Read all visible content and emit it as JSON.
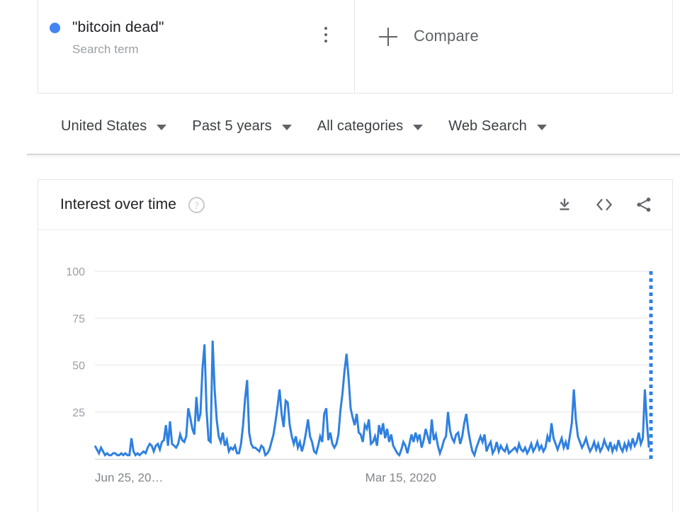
{
  "search_term": {
    "label": "\"bitcoin dead\"",
    "type_label": "Search term",
    "dot_color": "#4285f4",
    "menu_icon": "kebab-menu-icon"
  },
  "compare": {
    "label": "Compare",
    "icon": "plus-icon"
  },
  "filters": [
    {
      "label": "United States",
      "name": "region"
    },
    {
      "label": "Past 5 years",
      "name": "time-range"
    },
    {
      "label": "All categories",
      "name": "category"
    },
    {
      "label": "Web Search",
      "name": "search-type"
    }
  ],
  "card": {
    "title": "Interest over time",
    "help_icon": "question-mark-icon",
    "actions": [
      {
        "name": "download-csv-button",
        "icon": "download-icon"
      },
      {
        "name": "embed-code-button",
        "icon": "code-brackets-icon"
      },
      {
        "name": "share-button",
        "icon": "share-icon"
      }
    ]
  },
  "chart_data": {
    "type": "line",
    "title": "Interest over time",
    "xlabel": "",
    "ylabel": "",
    "ylim": [
      0,
      100
    ],
    "yticks": [
      100,
      75,
      50,
      25
    ],
    "xticks": [
      {
        "label": "Jun 25, 20…",
        "pos": 0.0
      },
      {
        "label": "Mar 15, 2020",
        "pos": 0.55
      }
    ],
    "grid": true,
    "legend": false,
    "line_color": "#2f80e0",
    "series": [
      {
        "name": "\"bitcoin dead\"",
        "values": [
          7,
          5,
          3,
          6,
          4,
          2,
          3,
          2,
          2,
          3,
          3,
          2,
          2,
          3,
          2,
          3,
          2,
          2,
          11,
          4,
          2,
          3,
          2,
          3,
          4,
          3,
          6,
          8,
          7,
          4,
          7,
          8,
          5,
          9,
          10,
          18,
          7,
          20,
          8,
          7,
          6,
          8,
          13,
          10,
          9,
          12,
          27,
          22,
          16,
          13,
          33,
          20,
          24,
          48,
          61,
          26,
          10,
          9,
          63,
          37,
          21,
          12,
          9,
          14,
          7,
          10,
          4,
          6,
          5,
          7,
          3,
          3,
          8,
          18,
          32,
          42,
          14,
          8,
          6,
          6,
          5,
          4,
          7,
          6,
          2,
          3,
          5,
          9,
          13,
          20,
          28,
          37,
          24,
          17,
          31,
          30,
          18,
          12,
          8,
          12,
          6,
          9,
          4,
          8,
          14,
          21,
          12,
          9,
          4,
          3,
          7,
          12,
          9,
          24,
          27,
          10,
          14,
          8,
          6,
          8,
          13,
          26,
          35,
          47,
          56,
          43,
          27,
          22,
          18,
          24,
          14,
          13,
          9,
          18,
          16,
          21,
          8,
          9,
          12,
          7,
          18,
          13,
          19,
          11,
          16,
          9,
          13,
          7,
          5,
          3,
          2,
          5,
          9,
          7,
          3,
          8,
          13,
          9,
          14,
          10,
          13,
          6,
          10,
          16,
          12,
          8,
          21,
          10,
          13,
          7,
          3,
          6,
          10,
          12,
          25,
          15,
          11,
          9,
          13,
          14,
          8,
          12,
          19,
          24,
          15,
          9,
          4,
          2,
          6,
          9,
          12,
          9,
          13,
          4,
          7,
          9,
          3,
          5,
          9,
          4,
          7,
          5,
          4,
          7,
          3,
          4,
          5,
          6,
          4,
          8,
          5,
          4,
          6,
          3,
          5,
          8,
          4,
          6,
          9,
          5,
          7,
          4,
          6,
          12,
          9,
          19,
          11,
          8,
          5,
          8,
          11,
          6,
          9,
          5,
          12,
          19,
          37,
          21,
          12,
          9,
          6,
          8,
          11,
          7,
          4,
          6,
          9,
          5,
          8,
          4,
          6,
          10,
          7,
          5,
          9,
          4,
          7,
          5,
          10,
          6,
          4,
          8,
          5,
          9,
          6,
          11,
          7,
          9,
          14,
          8,
          11,
          37,
          19,
          6
        ]
      }
    ],
    "partial_segment": {
      "note": "final incomplete data point rendered as dotted vertical line",
      "value": 100,
      "style": "dotted"
    }
  }
}
